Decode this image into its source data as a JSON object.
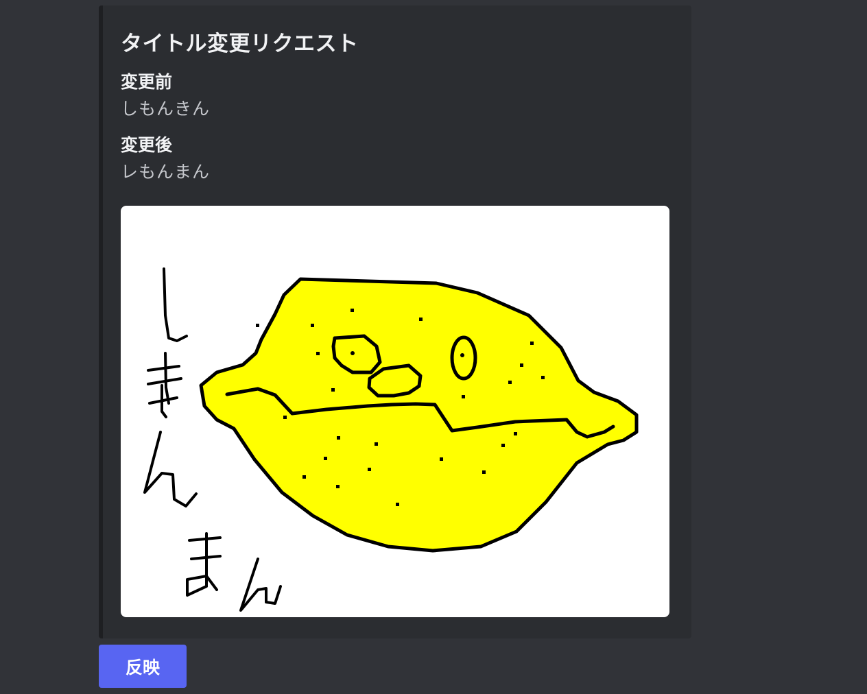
{
  "embed": {
    "title": "タイトル変更リクエスト",
    "fields": [
      {
        "name": "変更前",
        "value": "しもんきん"
      },
      {
        "name": "変更後",
        "value": "レもんまん"
      }
    ],
    "image": {
      "subject": "lemon-character-drawing",
      "handwritten_text": "しもんまん",
      "colors": {
        "fill": "#ffff00",
        "outline": "#000000",
        "background": "#ffffff"
      }
    }
  },
  "actions": {
    "apply_label": "反映"
  },
  "colors": {
    "background": "#313338",
    "embed_background": "#2b2d31",
    "embed_border": "#1e1f22",
    "button": "#5865f2"
  }
}
